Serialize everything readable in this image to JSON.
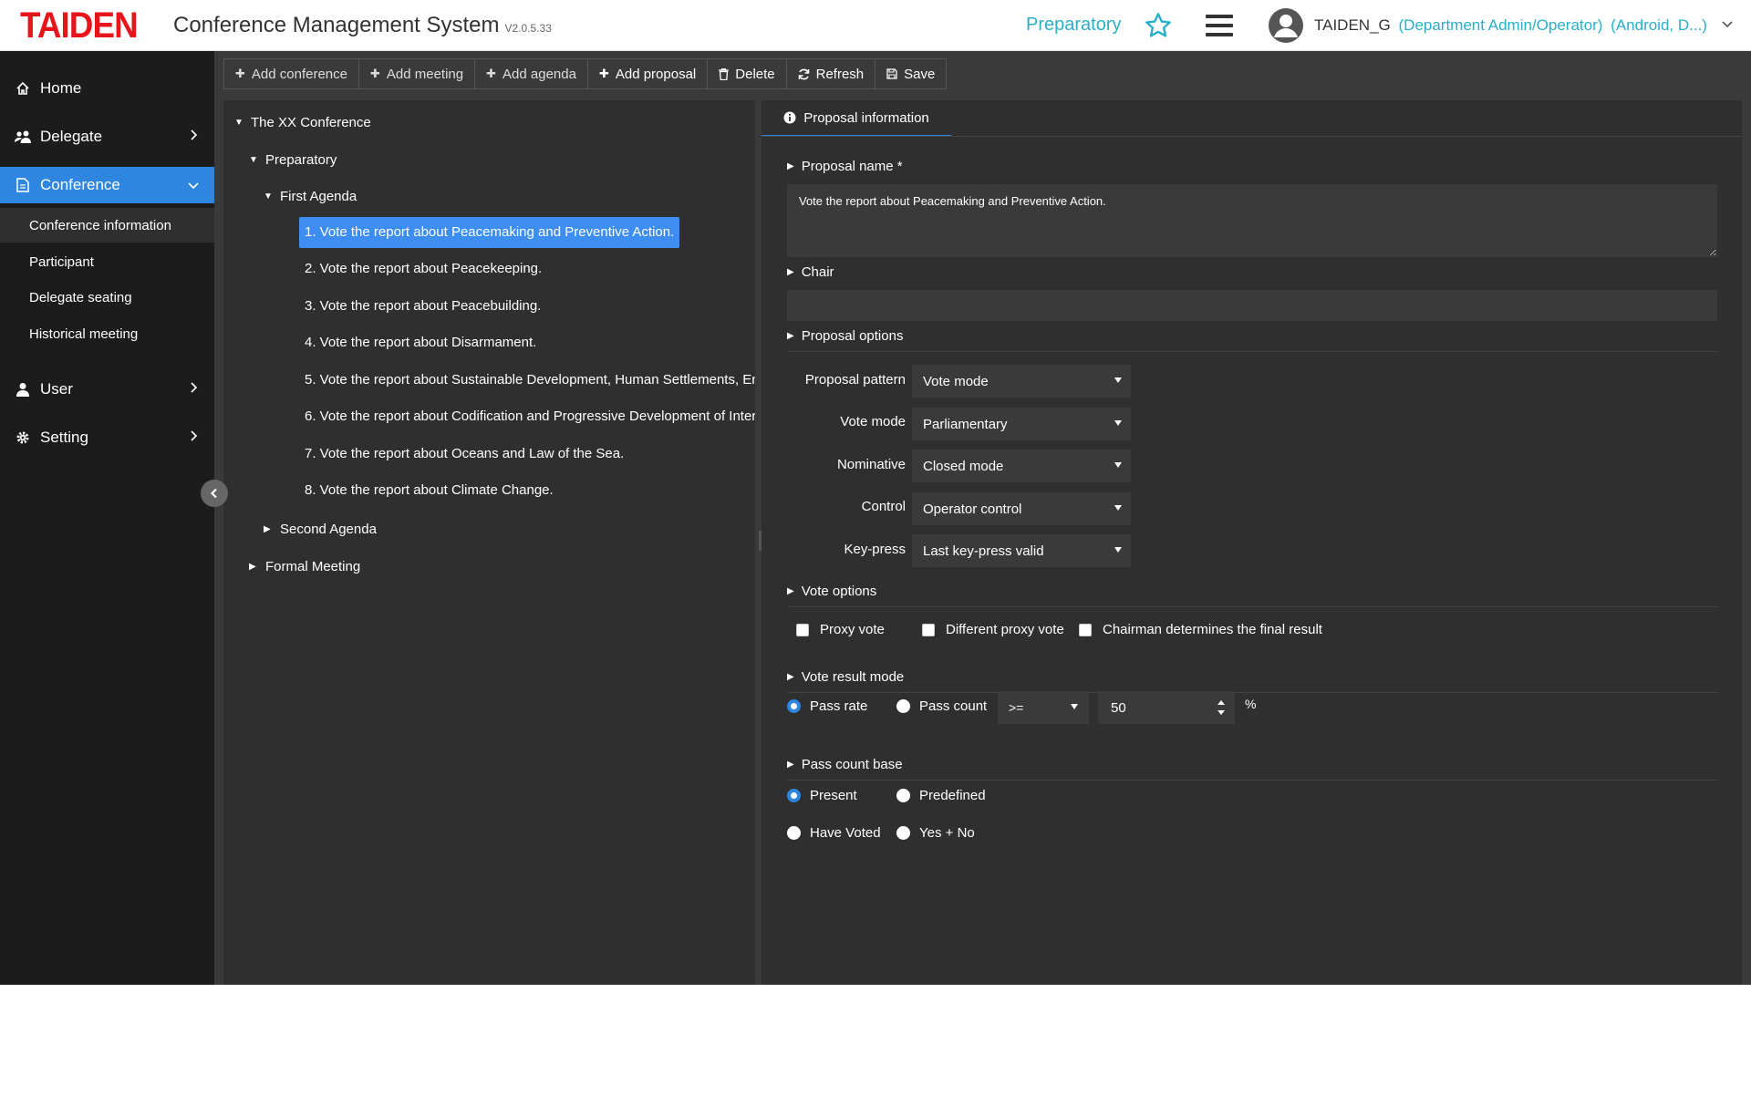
{
  "header": {
    "logo": "TAIDEN",
    "title": "Conference Management System",
    "version": "V2.0.5.33",
    "status": "Preparatory",
    "username": "TAIDEN_G",
    "role": "(Department Admin/Operator)",
    "device": "(Android, D...)"
  },
  "sidebar": {
    "home": "Home",
    "delegate": "Delegate",
    "conference": "Conference",
    "conference_sub": [
      "Conference information",
      "Participant",
      "Delegate seating",
      "Historical meeting"
    ],
    "user": "User",
    "setting": "Setting"
  },
  "toolbar": {
    "add_conference": "Add conference",
    "add_meeting": "Add meeting",
    "add_agenda": "Add agenda",
    "add_proposal": "Add proposal",
    "delete": "Delete",
    "refresh": "Refresh",
    "save": "Save"
  },
  "tree": {
    "root": "The XX Conference",
    "meeting1": "Preparatory",
    "agenda1": "First Agenda",
    "proposals": [
      "1. Vote the report about Peacemaking and Preventive Action.",
      "2. Vote the report about Peacekeeping.",
      "3. Vote the report about Peacebuilding.",
      "4. Vote the report about Disarmament.",
      "5. Vote the report about Sustainable Development, Human Settlements, En",
      "6. Vote the report about Codification and Progressive Development of Inter",
      "7. Vote the report about Oceans and Law of the Sea.",
      "8. Vote the report about Climate Change."
    ],
    "agenda2": "Second Agenda",
    "meeting2": "Formal Meeting"
  },
  "detail": {
    "tab": "Proposal information",
    "proposal_name_label": "Proposal name *",
    "proposal_name_value": "Vote the report about Peacemaking and Preventive Action.",
    "chair_label": "Chair",
    "chair_value": "",
    "proposal_options_label": "Proposal options",
    "options": {
      "pattern_label": "Proposal pattern",
      "pattern_value": "Vote mode",
      "vote_mode_label": "Vote mode",
      "vote_mode_value": "Parliamentary",
      "nominative_label": "Nominative",
      "nominative_value": "Closed mode",
      "control_label": "Control",
      "control_value": "Operator control",
      "keypress_label": "Key-press",
      "keypress_value": "Last key-press valid"
    },
    "vote_options_label": "Vote options",
    "vote_options": {
      "proxy": "Proxy vote",
      "diff_proxy": "Different proxy vote",
      "chairman": "Chairman determines the final result"
    },
    "vote_result_label": "Vote result mode",
    "vote_result": {
      "pass_rate": "Pass rate",
      "pass_count": "Pass count",
      "operator": ">=",
      "value": "50",
      "unit": "%"
    },
    "pass_base_label": "Pass count base",
    "pass_base": {
      "present": "Present",
      "predefined": "Predefined",
      "have_voted": "Have Voted",
      "yes_no": "Yes + No"
    }
  },
  "colors": {
    "accent": "#2e86de",
    "brand_red": "#e8141c",
    "teal": "#27b0c8",
    "panel_bg": "#2f2f2f",
    "sidebar_bg": "#1c1c1c"
  }
}
